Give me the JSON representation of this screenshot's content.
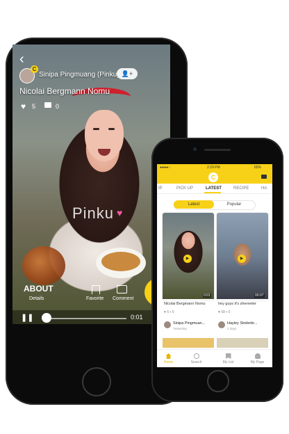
{
  "large_phone": {
    "username": "Sinipa Pingmuang (Pinku)",
    "video_title": "Nicolai Bergmann Nomu",
    "likes": "5",
    "comments": "0",
    "watermark": "Pinku",
    "about_label": "ABOUT",
    "details_label": "Details",
    "favorite_label": "Favorite",
    "comment_label": "Comment",
    "elapsed_time": "0:01",
    "follow_label": "+",
    "back_icon": "chevron-left-icon"
  },
  "small_phone": {
    "status": {
      "time": "2:29 PM",
      "battery": "65%",
      "carrier": "●●●●○"
    },
    "tabs": [
      "IP",
      "PICK UP",
      "LATEST",
      "RECIPE",
      "HA"
    ],
    "active_tab": "LATEST",
    "toggle": {
      "left": "Latest",
      "right": "Popular"
    },
    "cards": [
      {
        "title": "Nicolai Bergmann Nomu",
        "likes": "5",
        "comments": "0",
        "duration": "0:01",
        "user": "Sinipa Pingmuan...",
        "subtitle": "Yesterday"
      },
      {
        "title": "hey guys it's shereeter",
        "likes": "58",
        "comments": "0",
        "duration": "00:07",
        "user": "Hayley Sinderbr...",
        "subtitle": "2 days"
      }
    ],
    "tabbar": [
      "Home",
      "Search",
      "My List",
      "My Page"
    ],
    "active_tabbar": "Home"
  },
  "colors": {
    "accent": "#f7d117",
    "heart": "#f25a9c"
  }
}
